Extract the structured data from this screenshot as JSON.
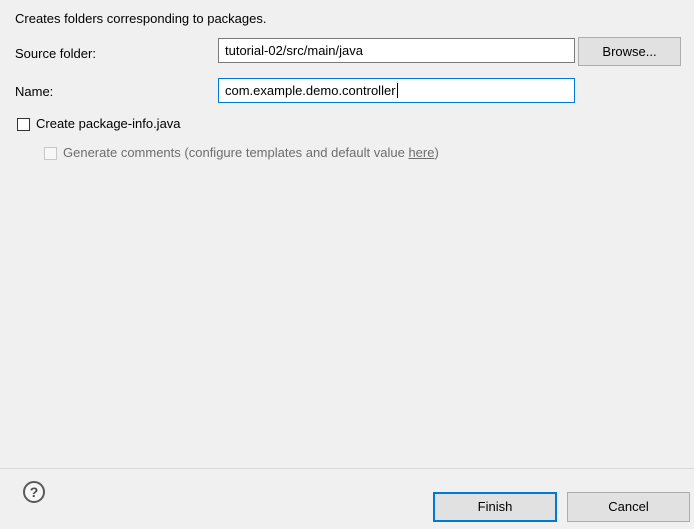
{
  "description": "Creates folders corresponding to packages.",
  "source_folder": {
    "label": "Source folder:",
    "value": "tutorial-02/src/main/java",
    "browse_label": "Browse..."
  },
  "name": {
    "label": "Name:",
    "value": "com.example.demo.controller"
  },
  "create_package_info": {
    "label": "Create package-info.java",
    "checked": false
  },
  "generate_comments": {
    "label": "Generate comments",
    "hint_prefix": "(configure templates and default value ",
    "link": "here",
    "hint_suffix": ")",
    "checked": false,
    "enabled": false
  },
  "footer": {
    "help_icon": "help-icon",
    "help_glyph": "?",
    "finish_label": "Finish",
    "cancel_label": "Cancel"
  }
}
